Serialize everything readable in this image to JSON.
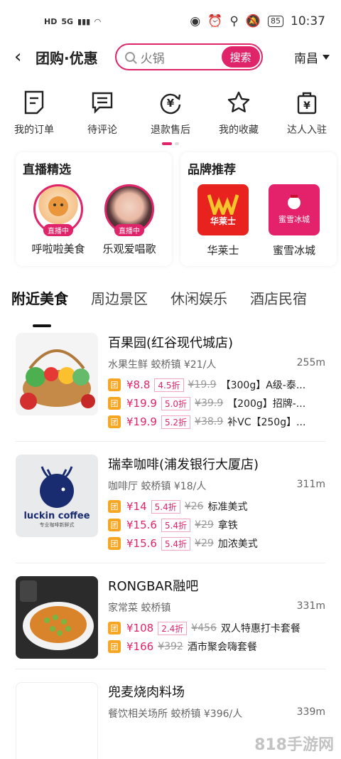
{
  "status_bar": {
    "hd": "HD",
    "signal": "5G",
    "battery": "85",
    "time": "10:37"
  },
  "header": {
    "back_icon": "chevron-left-icon",
    "title": "团购·优惠",
    "search_value": "火锅",
    "search_button": "搜索",
    "city": "南昌"
  },
  "quick_actions": [
    {
      "label": "我的订单",
      "icon": "order-icon"
    },
    {
      "label": "待评论",
      "icon": "comment-icon"
    },
    {
      "label": "退款售后",
      "icon": "refund-icon"
    },
    {
      "label": "我的收藏",
      "icon": "star-icon"
    },
    {
      "label": "达人入驻",
      "icon": "bag-icon"
    }
  ],
  "live_card": {
    "title": "直播精选",
    "badge": "直播中",
    "items": [
      {
        "name": "呼啦啦美食"
      },
      {
        "name": "乐观爱唱歌"
      }
    ]
  },
  "brand_card": {
    "title": "品牌推荐",
    "items": [
      {
        "name": "华莱士",
        "logo_text": "华莱士"
      },
      {
        "name": "蜜雪冰城",
        "logo_text": "蜜雪冰城"
      }
    ]
  },
  "tabs": [
    "附近美食",
    "周边景区",
    "休闲娱乐",
    "酒店民宿"
  ],
  "shops": [
    {
      "name": "百果园(红谷现代城店)",
      "meta": "水果生鲜  蛟桥镇  ¥21/人",
      "distance": "255m",
      "deals": [
        {
          "price": "¥8.8",
          "discount": "4.5折",
          "orig": "¥19.9",
          "desc": "【300g】A级-泰..."
        },
        {
          "price": "¥19.9",
          "discount": "5.0折",
          "orig": "¥39.9",
          "desc": "【200g】招牌-..."
        },
        {
          "price": "¥19.9",
          "discount": "5.2折",
          "orig": "¥38.9",
          "desc": "补VC【250g】..."
        }
      ]
    },
    {
      "name": "瑞幸咖啡(浦发银行大厦店)",
      "meta": "咖啡厅  蛟桥镇  ¥18/人",
      "distance": "311m",
      "logo_text": "luckin coffee",
      "logo_sub": "专业咖啡新鲜式",
      "deals": [
        {
          "price": "¥14",
          "discount": "5.4折",
          "orig": "¥26",
          "desc": "标准美式"
        },
        {
          "price": "¥15.6",
          "discount": "5.4折",
          "orig": "¥29",
          "desc": "拿铁"
        },
        {
          "price": "¥15.6",
          "discount": "5.4折",
          "orig": "¥29",
          "desc": "加浓美式"
        }
      ]
    },
    {
      "name": "RONGBAR融吧",
      "meta": "家常菜  蛟桥镇",
      "distance": "331m",
      "deals": [
        {
          "price": "¥108",
          "discount": "2.4折",
          "orig": "¥456",
          "desc": "双人特惠打卡套餐"
        },
        {
          "price": "¥166",
          "discount": "",
          "orig": "¥392",
          "desc": "酒市聚会嗨套餐"
        }
      ]
    },
    {
      "name": "兜麦烧肉料场",
      "meta": "餐饮相关场所  蛟桥镇  ¥396/人",
      "distance": "339m",
      "deals": []
    }
  ],
  "tuan_label": "团",
  "watermark": "818手游网"
}
